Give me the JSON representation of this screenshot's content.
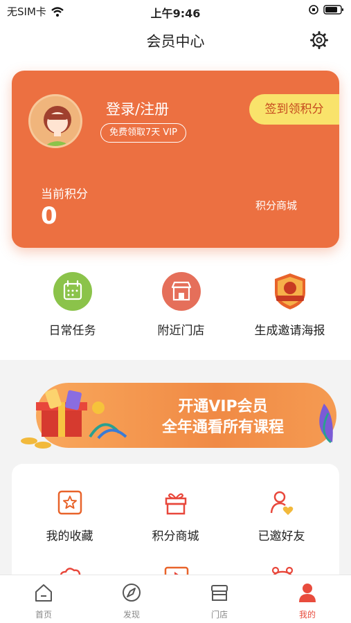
{
  "status_bar": {
    "carrier": "无SIM卡",
    "time": "上午9:46"
  },
  "nav": {
    "title": "会员中心"
  },
  "member_card": {
    "login_label": "登录/注册",
    "vip_pill": "免费领取7天 VIP",
    "signin_button": "签到领积分",
    "points_label": "当前积分",
    "points_value": "0",
    "points_mall": "积分商城"
  },
  "quick_actions": [
    {
      "label": "日常任务",
      "icon": "calendar-icon",
      "color": "#8bc34a"
    },
    {
      "label": "附近门店",
      "icon": "store-icon",
      "color": "#e56f5a"
    },
    {
      "label": "生成邀请海报",
      "icon": "invite-badge-icon",
      "color": "#e8632a"
    }
  ],
  "vip_banner": {
    "line1": "开通VIP会员",
    "line2": "全年通看所有课程"
  },
  "grid_items": [
    {
      "label": "我的收藏",
      "icon": "star-box-icon"
    },
    {
      "label": "积分商城",
      "icon": "gift-icon"
    },
    {
      "label": "已邀好友",
      "icon": "user-heart-icon"
    }
  ],
  "tabbar": [
    {
      "label": "首页",
      "icon": "home-icon",
      "active": false
    },
    {
      "label": "发现",
      "icon": "compass-icon",
      "active": false
    },
    {
      "label": "门店",
      "icon": "shop-icon",
      "active": false
    },
    {
      "label": "我的",
      "icon": "person-icon",
      "active": true
    }
  ],
  "colors": {
    "accent": "#ec7041",
    "signin": "#f9e36b",
    "tab_active": "#e84c3d"
  }
}
